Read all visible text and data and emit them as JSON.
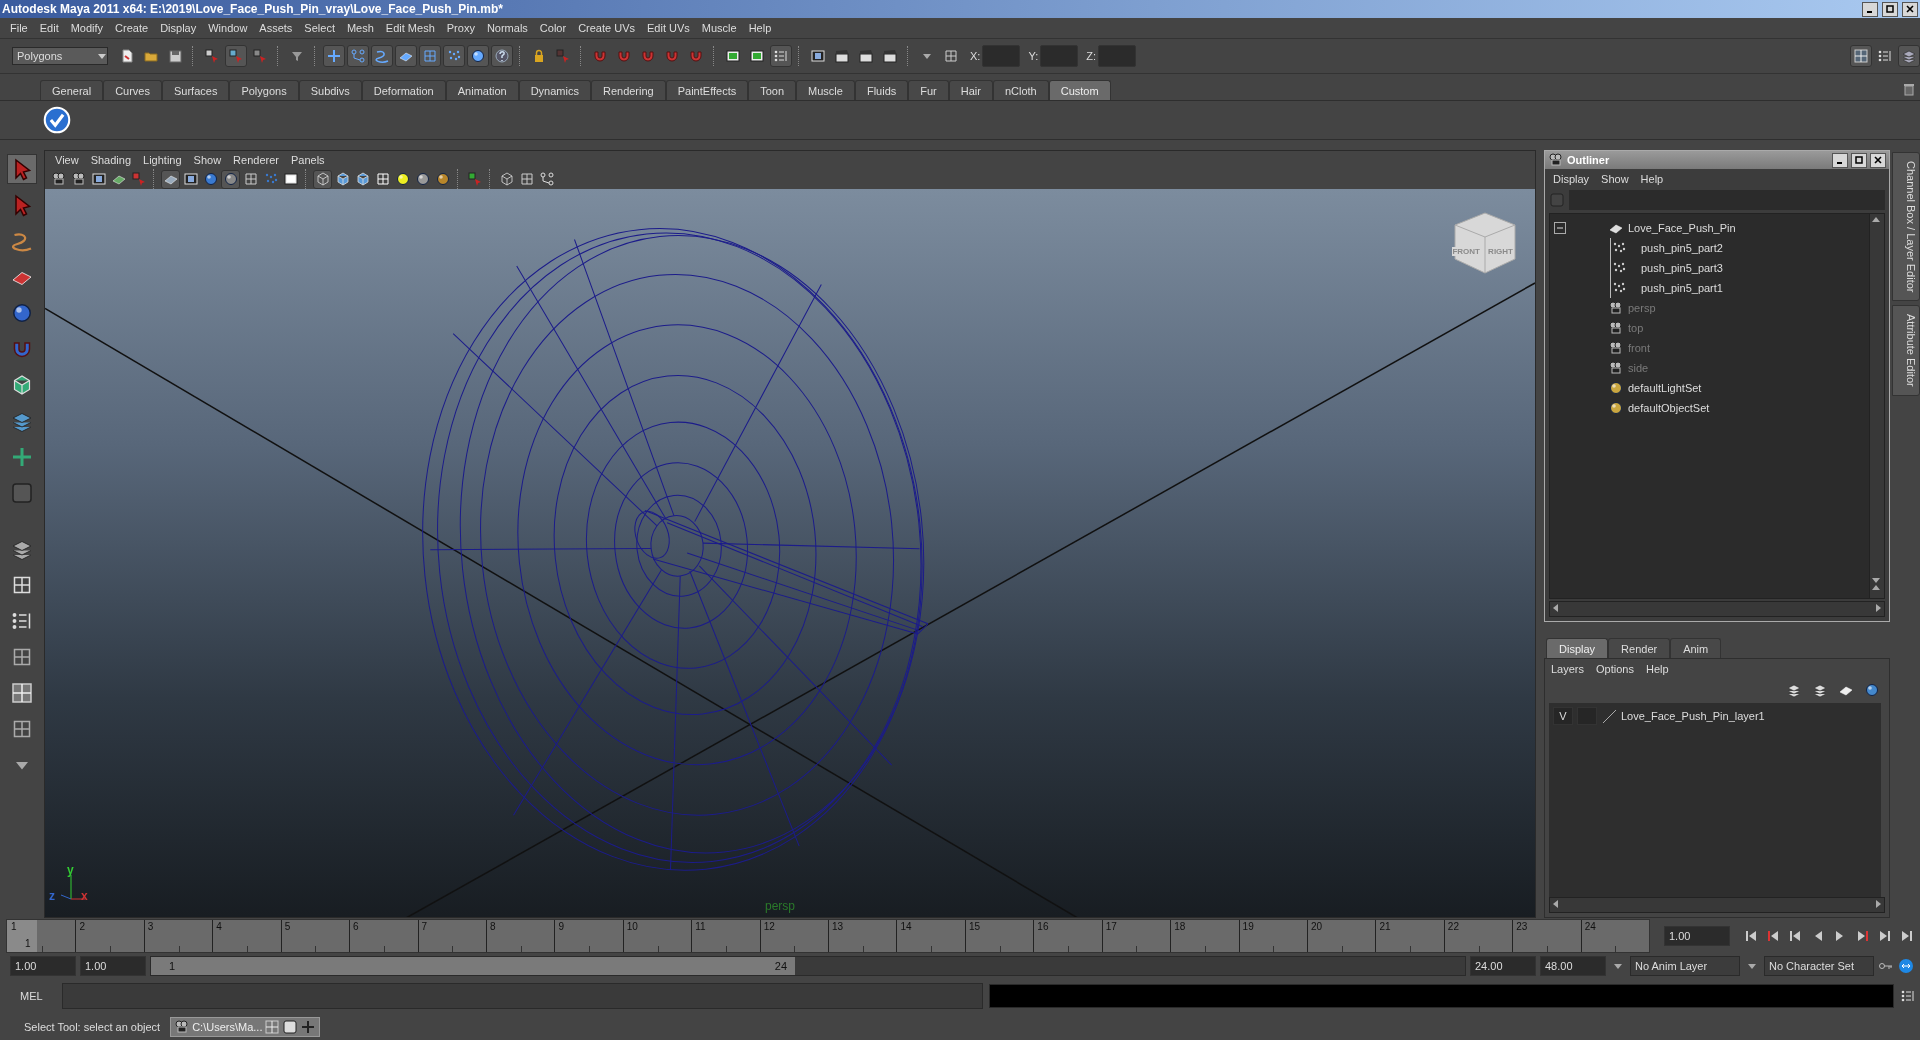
{
  "window": {
    "title": "Autodesk Maya 2011 x64: E:\\2019\\Love_Face_Push_Pin_vray\\Love_Face_Push_Pin.mb*"
  },
  "menu_bar": [
    "File",
    "Edit",
    "Modify",
    "Create",
    "Display",
    "Window",
    "Assets",
    "Select",
    "Mesh",
    "Edit Mesh",
    "Proxy",
    "Normals",
    "Color",
    "Create UVs",
    "Edit UVs",
    "Muscle",
    "Help"
  ],
  "toolbar": {
    "mode_dropdown": "Polygons",
    "coordinate_labels": [
      "X:",
      "Y:",
      "Z:"
    ]
  },
  "shelf_tabs": [
    {
      "label": "General",
      "selected": false
    },
    {
      "label": "Curves",
      "selected": false
    },
    {
      "label": "Surfaces",
      "selected": false
    },
    {
      "label": "Polygons",
      "selected": false
    },
    {
      "label": "Subdivs",
      "selected": false
    },
    {
      "label": "Deformation",
      "selected": false
    },
    {
      "label": "Animation",
      "selected": false
    },
    {
      "label": "Dynamics",
      "selected": false
    },
    {
      "label": "Rendering",
      "selected": false
    },
    {
      "label": "PaintEffects",
      "selected": false
    },
    {
      "label": "Toon",
      "selected": false
    },
    {
      "label": "Muscle",
      "selected": false
    },
    {
      "label": "Fluids",
      "selected": false
    },
    {
      "label": "Fur",
      "selected": false
    },
    {
      "label": "Hair",
      "selected": false
    },
    {
      "label": "nCloth",
      "selected": false
    },
    {
      "label": "Custom",
      "selected": true
    }
  ],
  "viewport": {
    "menu": [
      "View",
      "Shading",
      "Lighting",
      "Show",
      "Renderer",
      "Panels"
    ],
    "camera_label": "persp",
    "view_cube_labels": [
      "FRONT",
      "RIGHT"
    ],
    "axis_labels": [
      "y",
      "x",
      "z"
    ]
  },
  "outliner": {
    "title": "Outliner",
    "menu": [
      "Display",
      "Show",
      "Help"
    ],
    "items": [
      {
        "label": "Love_Face_Push_Pin",
        "kind": "group",
        "hidden": false,
        "expanded": true,
        "children": [
          {
            "label": "push_pin5_part2",
            "kind": "mesh",
            "hidden": false
          },
          {
            "label": "push_pin5_part3",
            "kind": "mesh",
            "hidden": false
          },
          {
            "label": "push_pin5_part1",
            "kind": "mesh",
            "hidden": false
          }
        ]
      },
      {
        "label": "persp",
        "kind": "camera",
        "hidden": true
      },
      {
        "label": "top",
        "kind": "camera",
        "hidden": true
      },
      {
        "label": "front",
        "kind": "camera",
        "hidden": true
      },
      {
        "label": "side",
        "kind": "camera",
        "hidden": true
      },
      {
        "label": "defaultLightSet",
        "kind": "set",
        "hidden": false
      },
      {
        "label": "defaultObjectSet",
        "kind": "set",
        "hidden": false
      }
    ]
  },
  "layer_editor": {
    "tabs": [
      {
        "label": "Display",
        "selected": true
      },
      {
        "label": "Render",
        "selected": false
      },
      {
        "label": "Anim",
        "selected": false
      }
    ],
    "menu": [
      "Layers",
      "Options",
      "Help"
    ],
    "layers": [
      {
        "visibility": "V",
        "name": "Love_Face_Push_Pin_layer1"
      }
    ]
  },
  "side_tabs": [
    "Channel Box / Layer Editor",
    "Attribute Editor"
  ],
  "timeline": {
    "ticks": [
      "1",
      "2",
      "3",
      "4",
      "5",
      "6",
      "7",
      "8",
      "9",
      "10",
      "11",
      "12",
      "13",
      "14",
      "15",
      "16",
      "17",
      "18",
      "19",
      "20",
      "21",
      "22",
      "23",
      "24"
    ],
    "current_frame": "1",
    "level": 0,
    "current_time": "1.00"
  },
  "range": {
    "start": "1.00",
    "playback_start": "1.00",
    "slider_start": "1",
    "slider_end": "24",
    "level": 0.49,
    "playback_end": "24.00",
    "end": "48.00",
    "anim_layer": "No Anim Layer",
    "character_set": "No Character Set"
  },
  "command_line": {
    "label": "MEL"
  },
  "status_bar": {
    "message": "Select Tool: select an object",
    "task": "C:\\Users\\Ma..."
  }
}
